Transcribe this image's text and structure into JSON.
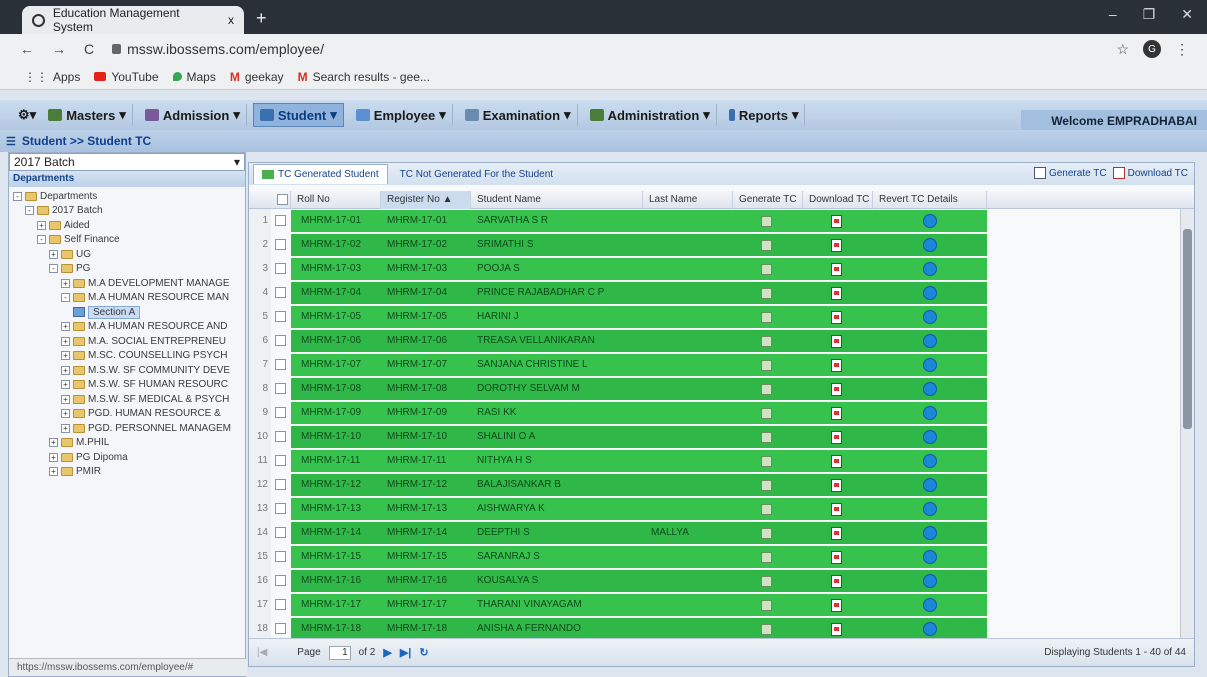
{
  "browser": {
    "tab_title": "Education Management System",
    "tab_close": "x",
    "new_tab": "+",
    "url": "mssw.ibossems.com/employee/",
    "bookmarks": [
      "Apps",
      "YouTube",
      "Maps",
      "geekay",
      "Search results - gee..."
    ],
    "status_url": "https://mssw.ibossems.com/employee/#"
  },
  "menu": {
    "items": [
      "Masters",
      "Admission",
      "Student",
      "Employee",
      "Examination",
      "Administration",
      "Reports"
    ],
    "active": "Student",
    "welcome": "Welcome EMPRADHABAI"
  },
  "breadcrumb": "Student >> Student TC",
  "left": {
    "batch": "2017 Batch",
    "header": "Departments",
    "tree": [
      {
        "label": "Departments",
        "level": 0,
        "type": "folder",
        "toggle": "-"
      },
      {
        "label": "2017 Batch",
        "level": 1,
        "type": "folder",
        "toggle": "-"
      },
      {
        "label": "Aided",
        "level": 2,
        "type": "folder",
        "toggle": "+"
      },
      {
        "label": "Self Finance",
        "level": 2,
        "type": "folder",
        "toggle": "-"
      },
      {
        "label": "UG",
        "level": 3,
        "type": "folder",
        "toggle": "+"
      },
      {
        "label": "PG",
        "level": 3,
        "type": "folder",
        "toggle": "-"
      },
      {
        "label": "M.A DEVELOPMENT MANAGE",
        "level": 4,
        "type": "folder",
        "toggle": "+"
      },
      {
        "label": "M.A HUMAN RESOURCE MAN",
        "level": 4,
        "type": "folder",
        "toggle": "-"
      },
      {
        "label": "Section A",
        "level": 5,
        "type": "leaf",
        "toggle": "",
        "selected": true
      },
      {
        "label": "M.A HUMAN RESOURCE AND",
        "level": 4,
        "type": "folder",
        "toggle": "+"
      },
      {
        "label": "M.A. SOCIAL ENTREPRENEU",
        "level": 4,
        "type": "folder",
        "toggle": "+"
      },
      {
        "label": "M.SC. COUNSELLING PSYCH",
        "level": 4,
        "type": "folder",
        "toggle": "+"
      },
      {
        "label": "M.S.W. SF COMMUNITY DEVE",
        "level": 4,
        "type": "folder",
        "toggle": "+"
      },
      {
        "label": "M.S.W. SF HUMAN RESOURC",
        "level": 4,
        "type": "folder",
        "toggle": "+"
      },
      {
        "label": "M.S.W. SF MEDICAL & PSYCH",
        "level": 4,
        "type": "folder",
        "toggle": "+"
      },
      {
        "label": "PGD. HUMAN RESOURCE &",
        "level": 4,
        "type": "folder",
        "toggle": "+"
      },
      {
        "label": "PGD. PERSONNEL MANAGEM",
        "level": 4,
        "type": "folder",
        "toggle": "+"
      },
      {
        "label": "M.PHIL",
        "level": 3,
        "type": "folder",
        "toggle": "+"
      },
      {
        "label": "PG Dipoma",
        "level": 3,
        "type": "folder",
        "toggle": "+"
      },
      {
        "label": "PMIR",
        "level": 3,
        "type": "folder",
        "toggle": "+"
      }
    ]
  },
  "grid": {
    "tabs": [
      "TC Generated Student",
      "TC Not Generated For the Student"
    ],
    "buttons": [
      "Generate TC",
      "Download TC"
    ],
    "columns": [
      "Roll No",
      "Register No ▲",
      "Student Name",
      "Last Name",
      "Generate TC",
      "Download TC",
      "Revert TC Details"
    ],
    "rows": [
      {
        "n": "1",
        "roll": "MHRM-17-01",
        "reg": "MHRM-17-01",
        "name": "SARVATHA S R",
        "last": ""
      },
      {
        "n": "2",
        "roll": "MHRM-17-02",
        "reg": "MHRM-17-02",
        "name": "SRIMATHI S",
        "last": ""
      },
      {
        "n": "3",
        "roll": "MHRM-17-03",
        "reg": "MHRM-17-03",
        "name": "POOJA S",
        "last": ""
      },
      {
        "n": "4",
        "roll": "MHRM-17-04",
        "reg": "MHRM-17-04",
        "name": "PRINCE RAJABADHAR C P",
        "last": ""
      },
      {
        "n": "5",
        "roll": "MHRM-17-05",
        "reg": "MHRM-17-05",
        "name": "HARINI J",
        "last": ""
      },
      {
        "n": "6",
        "roll": "MHRM-17-06",
        "reg": "MHRM-17-06",
        "name": "TREASA VELLANIKARAN",
        "last": ""
      },
      {
        "n": "7",
        "roll": "MHRM-17-07",
        "reg": "MHRM-17-07",
        "name": "SANJANA CHRISTINE L",
        "last": ""
      },
      {
        "n": "8",
        "roll": "MHRM-17-08",
        "reg": "MHRM-17-08",
        "name": "DOROTHY SELVAM M",
        "last": ""
      },
      {
        "n": "9",
        "roll": "MHRM-17-09",
        "reg": "MHRM-17-09",
        "name": "RASI KK",
        "last": ""
      },
      {
        "n": "10",
        "roll": "MHRM-17-10",
        "reg": "MHRM-17-10",
        "name": "SHALINI O A",
        "last": ""
      },
      {
        "n": "11",
        "roll": "MHRM-17-11",
        "reg": "MHRM-17-11",
        "name": "NITHYA H S",
        "last": ""
      },
      {
        "n": "12",
        "roll": "MHRM-17-12",
        "reg": "MHRM-17-12",
        "name": "BALAJISANKAR B",
        "last": ""
      },
      {
        "n": "13",
        "roll": "MHRM-17-13",
        "reg": "MHRM-17-13",
        "name": "AISHWARYA K",
        "last": ""
      },
      {
        "n": "14",
        "roll": "MHRM-17-14",
        "reg": "MHRM-17-14",
        "name": "DEEPTHI S",
        "last": "MALLYA"
      },
      {
        "n": "15",
        "roll": "MHRM-17-15",
        "reg": "MHRM-17-15",
        "name": "SARANRAJ S",
        "last": ""
      },
      {
        "n": "16",
        "roll": "MHRM-17-16",
        "reg": "MHRM-17-16",
        "name": "KOUSALYA S",
        "last": ""
      },
      {
        "n": "17",
        "roll": "MHRM-17-17",
        "reg": "MHRM-17-17",
        "name": "THARANI VINAYAGAM",
        "last": ""
      },
      {
        "n": "18",
        "roll": "MHRM-17-18",
        "reg": "MHRM-17-18",
        "name": "ANISHA A FERNANDO",
        "last": ""
      }
    ],
    "pager": {
      "page_label": "Page",
      "page": "1",
      "of": "of 2"
    },
    "display_msg": "Displaying Students 1 - 40 of 44"
  },
  "colors": {
    "row_green": "#36c24d",
    "menu_bg": "#cbdcee",
    "accent_blue": "#15428b"
  }
}
